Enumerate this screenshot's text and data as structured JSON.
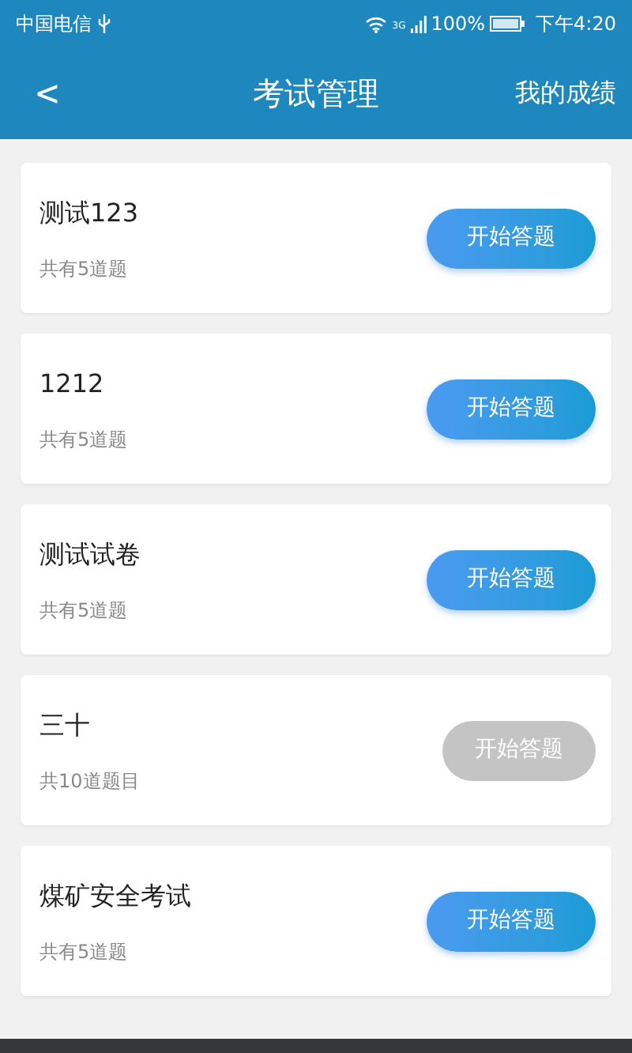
{
  "status_bar": {
    "carrier": "中国电信",
    "network": "3G",
    "battery": "100%",
    "time": "下午4:20"
  },
  "header": {
    "back": "<",
    "title": "考试管理",
    "action": "我的成绩"
  },
  "exams": [
    {
      "name": "测试123",
      "count": "共有5道题",
      "button": "开始答题",
      "disabled": false
    },
    {
      "name": "1212",
      "count": "共有5道题",
      "button": "开始答题",
      "disabled": false
    },
    {
      "name": "测试试卷",
      "count": "共有5道题",
      "button": "开始答题",
      "disabled": false
    },
    {
      "name": "三十",
      "count": "共10道题目",
      "button": "开始答题",
      "disabled": true
    },
    {
      "name": "煤矿安全考试",
      "count": "共有5道题",
      "button": "开始答题",
      "disabled": false
    }
  ]
}
